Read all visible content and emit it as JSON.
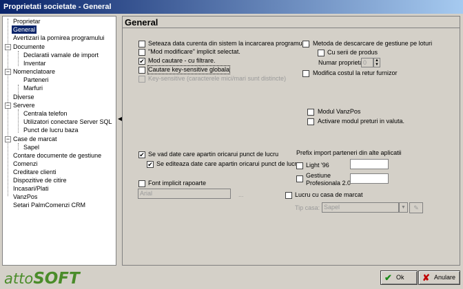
{
  "window": {
    "title": "Proprietati societate - General"
  },
  "tree": {
    "items": [
      {
        "label": "Proprietar"
      },
      {
        "label": "General"
      },
      {
        "label": "Avertizari la pornirea programului"
      },
      {
        "label": "Documente"
      },
      {
        "label": "Declaratii vamale de import"
      },
      {
        "label": "Inventar"
      },
      {
        "label": "Nomenclatoare"
      },
      {
        "label": "Parteneri"
      },
      {
        "label": "Marfuri"
      },
      {
        "label": "Diverse"
      },
      {
        "label": "Servere"
      },
      {
        "label": "Centrala telefon"
      },
      {
        "label": "Utilizatori conectare Server SQL"
      },
      {
        "label": "Punct de lucru baza"
      },
      {
        "label": "Case de marcat"
      },
      {
        "label": "Sapel"
      },
      {
        "label": "Contare documente de gestiune"
      },
      {
        "label": "Comenzi"
      },
      {
        "label": "Creditare clienti"
      },
      {
        "label": "Dispozitive de citire"
      },
      {
        "label": "Incasari/Plati"
      },
      {
        "label": "VanzPos"
      },
      {
        "label": "Setari PalmComenzi CRM"
      }
    ],
    "expand_symbol": "−"
  },
  "main": {
    "header": "General",
    "options": {
      "seteaza_data": "Seteaza data curenta din sistem la incarcarea programului.",
      "mod_modificare": "\"Mod modificare\"  implicit selectat.",
      "mod_cautare": "Mod cautare - cu filtrare.",
      "cautare_key": "Cautare key-sensitive globala",
      "key_sensitive": "Key-sensitive (caracterele mici/mari sunt distincte)",
      "metoda_descarcare": "Metoda de descarcare de gestiune pe loturi",
      "cu_serii": "Cu serii de produs",
      "numar_proprietati": "Numar proprietati:",
      "numar_proprietati_value": "0",
      "modifica_costul": "Modifica costul la retur furnizor",
      "modul_vanzpos": "Modul VanzPos",
      "activare_modul": "Activare modul preturi in valuta.",
      "se_vad": "Se vad date care apartin oricarui punct de lucru",
      "se_editeaza": "Se editeaza date care apartin oricarui punct de lucru",
      "font_implicit": "Font implicit rapoarte",
      "font_value": "Arial",
      "font_button": "...",
      "prefix_title": "Prefix import parteneri din alte aplicatii",
      "light96": "Light '96",
      "gestiune_line1": "Gestiune",
      "gestiune_line2": "Profesionala 2.0",
      "lucru_casa": "Lucru cu casa de marcat",
      "tip_casa": "Tip casa:",
      "tip_casa_value": "Sapel"
    },
    "checks": {
      "checked_mark": "✔"
    }
  },
  "footer": {
    "logo_part1": "atto",
    "logo_part2": "SOFT",
    "ok_label": "Ok",
    "cancel_label": "Anulare",
    "ok_icon": "✔",
    "cancel_icon": "✘"
  },
  "colors": {
    "title_start": "#0a246a",
    "title_end": "#a6caf0",
    "face": "#d4d0c8",
    "logo": "#4a8c2a",
    "ok_icon": "#1a8a1a",
    "cancel_icon": "#c00000"
  }
}
